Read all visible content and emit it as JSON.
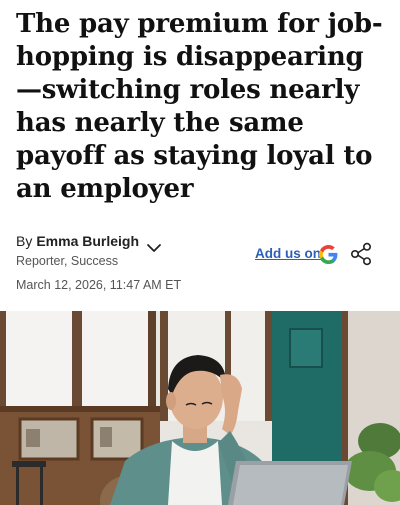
{
  "article": {
    "headline": "The pay premium for job-hopping is disappearing—switching roles nearly has nearly the same payoff as staying loyal to an employer",
    "byline_prefix": "By",
    "author_name": "Emma Burleigh",
    "author_title": "Reporter, Success",
    "date": "March 12, 2026, 11:47 AM ET"
  },
  "actions": {
    "add_us_label": "Add us on"
  },
  "icons": {
    "author_menu": "chevron-down-icon",
    "google": "google-logo-icon",
    "share": "share-icon"
  },
  "colors": {
    "link": "#2d5fb5",
    "wall_teal": "#1f6b66",
    "sweater": "#5e8f8b"
  }
}
